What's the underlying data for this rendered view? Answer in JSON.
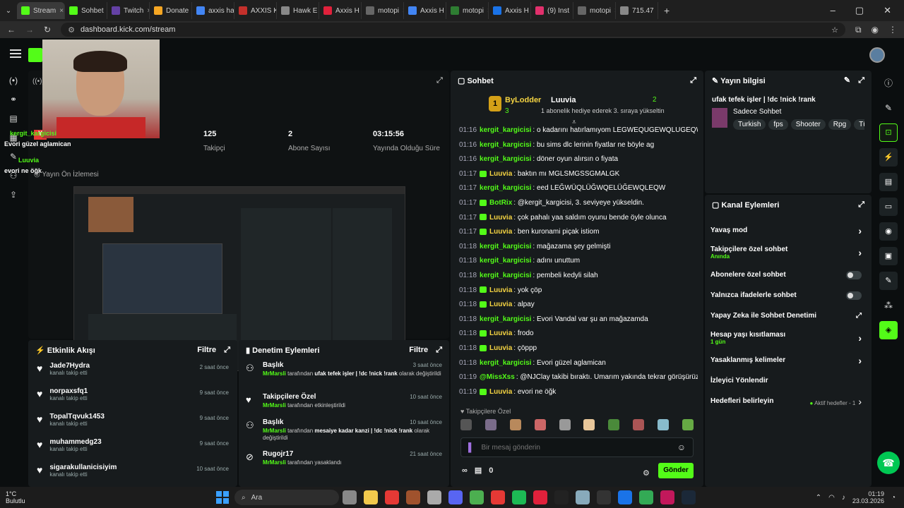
{
  "browser": {
    "tabs": [
      {
        "label": "Stream",
        "color": "#53fc18",
        "active": true
      },
      {
        "label": "Sohbet",
        "color": "#53fc18"
      },
      {
        "label": "Twitch",
        "color": "#6441a5"
      },
      {
        "label": "Donate",
        "color": "#f5a623"
      },
      {
        "label": "axxis ha",
        "color": "#4285f4"
      },
      {
        "label": "AXXIS K",
        "color": "#c4302b"
      },
      {
        "label": "Hawk E",
        "color": "#888"
      },
      {
        "label": "Axxis H",
        "color": "#e0213b"
      },
      {
        "label": "motopi",
        "color": "#666"
      },
      {
        "label": "Axxis H",
        "color": "#4285f4"
      },
      {
        "label": "motopi",
        "color": "#2e7d32"
      },
      {
        "label": "Axxis H",
        "color": "#1a73e8"
      },
      {
        "label": "(9) Inst",
        "color": "#e1306c"
      },
      {
        "label": "motopi",
        "color": "#666"
      },
      {
        "label": "715.47",
        "color": "#888"
      }
    ],
    "url": "dashboard.kick.com/stream"
  },
  "stats": {
    "followers_value": "125",
    "followers_label": "Takipçi",
    "subs_value": "2",
    "subs_label": "Abone Sayısı",
    "uptime_value": "03:15:56",
    "uptime_label": "Yayında Olduğu Süre"
  },
  "preview": {
    "title": "Yayın Ön İzlemesi"
  },
  "overlay": {
    "user1": "kergit_kargicisi",
    "msg1": "Evori güzel aglamican",
    "user2": "Luuvia",
    "msg2": "evori ne öğk"
  },
  "activity": {
    "title": "Etkinlik Akışı",
    "filter": "Filtre",
    "items": [
      {
        "name": "Jade7Hydra",
        "sub": "kanalı takip etti",
        "ago": "2 saat önce"
      },
      {
        "name": "norpaxsfq1",
        "sub": "kanalı takip etti",
        "ago": "9 saat önce"
      },
      {
        "name": "TopalTqvuk1453",
        "sub": "kanalı takip etti",
        "ago": "9 saat önce"
      },
      {
        "name": "muhammedg23",
        "sub": "kanalı takip etti",
        "ago": "9 saat önce"
      },
      {
        "name": "sigarakullanicisiyim",
        "sub": "kanalı takip etti",
        "ago": "10 saat önce"
      }
    ]
  },
  "moderation": {
    "title": "Denetim Eylemleri",
    "filter": "Filtre",
    "items": [
      {
        "title": "Başlık",
        "ago": "3 saat önce",
        "user": "MrMarsli",
        "pre": "tarafından",
        "bold": "ufak tefek işler | !dc !nick !rank",
        "post": "olarak değiştirildi"
      },
      {
        "title": "Takipçilere Özel",
        "ago": "10 saat önce",
        "user": "MrMarsli",
        "pre": "tarafından etkinleştirildi",
        "bold": "",
        "post": ""
      },
      {
        "title": "Başlık",
        "ago": "10 saat önce",
        "user": "MrMarsli",
        "pre": "tarafından",
        "bold": "mesaiye kadar kanzi | !dc !nick !rank",
        "post": "olarak değiştirildi"
      },
      {
        "title": "Rugojr17",
        "ago": "21 saat önce",
        "user": "MrMarsli",
        "pre": "tarafından yasaklandı",
        "bold": "",
        "post": ""
      }
    ]
  },
  "chat": {
    "title": "Sohbet",
    "leader1": {
      "name": "ByLodder",
      "count": "3"
    },
    "leader2": {
      "name": "Luuvia",
      "count": "2",
      "note": "1 abonelik hediye ederek 3. sıraya yükseltin"
    },
    "messages": [
      {
        "time": "01:16",
        "user": "kergit_kargicisi",
        "color": "#53fc18",
        "text": "o kadarını hatırlamıyom LEGWEQUGEWQLUGEQW",
        "badge": false
      },
      {
        "time": "01:16",
        "user": "kergit_kargicisi",
        "color": "#53fc18",
        "text": "bu sims dlc lerinin fiyatlar ne böyle ag",
        "badge": false
      },
      {
        "time": "01:16",
        "user": "kergit_kargicisi",
        "color": "#53fc18",
        "text": "döner oyun alırsın o fiyata",
        "badge": false
      },
      {
        "time": "01:17",
        "user": "Luuvia",
        "color": "#f5d442",
        "text": "baktın mı MGLSMGSSGMALGK",
        "badge": true
      },
      {
        "time": "01:17",
        "user": "kergit_kargicisi",
        "color": "#53fc18",
        "text": "eed LEĞWÜQLÜĞWQELÜĞEWQLEQW",
        "badge": false
      },
      {
        "time": "01:17",
        "user": "BotRix",
        "color": "#53fc18",
        "text": "@kergit_kargicisi, 3. seviyeye yükseldin.",
        "badge": true
      },
      {
        "time": "01:17",
        "user": "Luuvia",
        "color": "#f5d442",
        "text": "çok pahalı yaa saldım oyunu bende öyle olunca",
        "badge": true
      },
      {
        "time": "01:17",
        "user": "Luuvia",
        "color": "#f5d442",
        "text": "ben kuronami piçak istiom",
        "badge": true
      },
      {
        "time": "01:18",
        "user": "kergit_kargicisi",
        "color": "#53fc18",
        "text": "mağazama şey gelmişti",
        "badge": false
      },
      {
        "time": "01:18",
        "user": "kergit_kargicisi",
        "color": "#53fc18",
        "text": "adını unuttum",
        "badge": false
      },
      {
        "time": "01:18",
        "user": "kergit_kargicisi",
        "color": "#53fc18",
        "text": "pembeli kedyli silah",
        "badge": false
      },
      {
        "time": "01:18",
        "user": "Luuvia",
        "color": "#f5d442",
        "text": "yok çöp",
        "badge": true
      },
      {
        "time": "01:18",
        "user": "Luuvia",
        "color": "#f5d442",
        "text": "alpay",
        "badge": true
      },
      {
        "time": "01:18",
        "user": "kergit_kargicisi",
        "color": "#53fc18",
        "text": "Evori Vandal var şu an mağazamda",
        "badge": false
      },
      {
        "time": "01:18",
        "user": "Luuvia",
        "color": "#f5d442",
        "text": "frodo",
        "badge": true
      },
      {
        "time": "01:18",
        "user": "Luuvia",
        "color": "#f5d442",
        "text": "çöppp",
        "badge": true
      },
      {
        "time": "01:18",
        "user": "kergit_kargicisi",
        "color": "#53fc18",
        "text": "Evori güzel aglamican",
        "badge": false
      },
      {
        "time": "01:19",
        "user": "@MissXss",
        "color": "#53fc18",
        "text": "@NJClay takibi bıraktı. Umarım yakında tekrar görüşürüz.",
        "badge": false
      },
      {
        "time": "01:19",
        "user": "Luuvia",
        "color": "#f5d442",
        "text": "evori ne öğk",
        "badge": true
      }
    ],
    "followers_only": "Takipçilere Özel",
    "placeholder": "Bir mesaj gönderin",
    "points": "0",
    "send": "Gönder"
  },
  "info": {
    "title": "Yayın bilgisi",
    "stream_title": "ufak tefek işler | !dc !nick !rank",
    "category": "Sadece Sohbet",
    "tags": [
      "Turkish",
      "fps",
      "Shooter",
      "Rpg",
      "Türk"
    ]
  },
  "channel_actions": {
    "title": "Kanal Eylemleri",
    "items": [
      {
        "label": "Yavaş mod",
        "sub": "",
        "kind": "chevron"
      },
      {
        "label": "Takipçilere özel sohbet",
        "sub": "Anında",
        "kind": "chevron"
      },
      {
        "label": "Abonelere özel sohbet",
        "sub": "",
        "kind": "toggle"
      },
      {
        "label": "Yalnızca ifadelerle sohbet",
        "sub": "",
        "kind": "toggle"
      },
      {
        "label": "Yapay Zeka ile Sohbet Denetimi",
        "sub": "",
        "kind": "external"
      },
      {
        "label": "Hesap yaşı kısıtlaması",
        "sub": "1 gün",
        "kind": "chevron"
      },
      {
        "label": "Yasaklanmış kelimeler",
        "sub": "",
        "kind": "chevron"
      },
      {
        "label": "İzleyici Yönlendir",
        "sub": "",
        "kind": "none"
      },
      {
        "label": "Hedefleri belirleyin",
        "sub": "",
        "kind": "goal",
        "extra": "Aktif hedefler - 1"
      }
    ]
  },
  "taskbar": {
    "weather_temp": "1°C",
    "weather_text": "Bulutlu",
    "search": "Ara",
    "time": "01:19",
    "date": "23.03.2026"
  }
}
